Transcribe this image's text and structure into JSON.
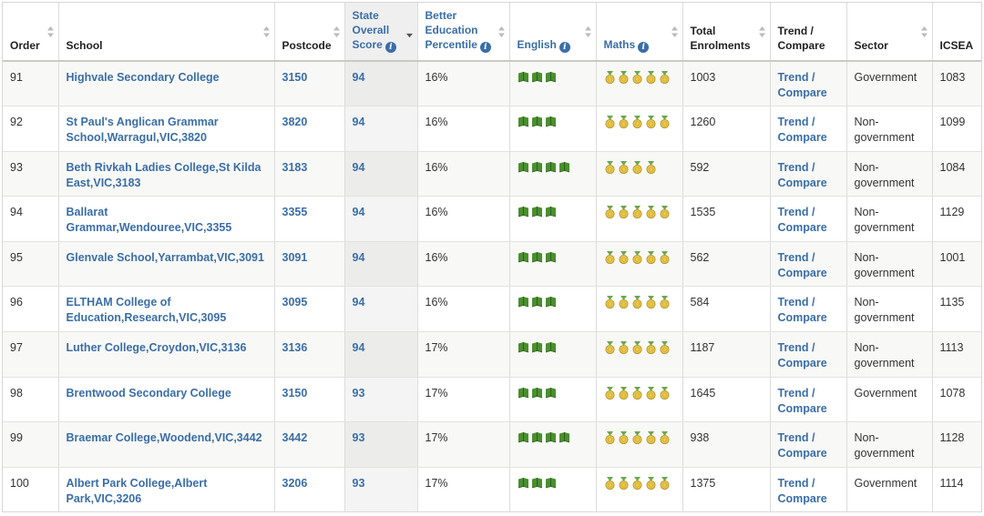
{
  "colors": {
    "link": "#3a6ea8",
    "book_green": "#4a8f2f",
    "medal_gold": "#e8c84a",
    "medal_ribbon": "#6aa84f"
  },
  "icons": {
    "english": "book-icon",
    "maths": "medal-icon",
    "info": "info-icon",
    "sort": "sort-arrows-icon"
  },
  "headers": {
    "order": "Order",
    "school": "School",
    "postcode": "Postcode",
    "state_score": [
      "State",
      "Overall",
      "Score"
    ],
    "better_education": [
      "Better",
      "Education",
      "Percentile"
    ],
    "english": "English",
    "maths": "Maths",
    "total": [
      "Total",
      "Enrolments"
    ],
    "trend": [
      "Trend /",
      "Compare"
    ],
    "sector": "Sector",
    "icsea": "ICSEA"
  },
  "sorted_by": "State Overall Score",
  "rows": [
    {
      "order": "91",
      "school": "Highvale Secondary College",
      "postcode": "3150",
      "score": "94",
      "percentile": "16%",
      "english": 3,
      "maths": 5,
      "total": "1003",
      "trend": [
        "Trend /",
        "Compare"
      ],
      "sector": "Government",
      "icsea": "1083"
    },
    {
      "order": "92",
      "school": "St Paul's Anglican Grammar School,Warragul,VIC,3820",
      "postcode": "3820",
      "score": "94",
      "percentile": "16%",
      "english": 3,
      "maths": 5,
      "total": "1260",
      "trend": [
        "Trend /",
        "Compare"
      ],
      "sector": "Non-government",
      "icsea": "1099"
    },
    {
      "order": "93",
      "school": "Beth Rivkah Ladies College,St Kilda East,VIC,3183",
      "postcode": "3183",
      "score": "94",
      "percentile": "16%",
      "english": 4,
      "maths": 4,
      "total": "592",
      "trend": [
        "Trend /",
        "Compare"
      ],
      "sector": "Non-government",
      "icsea": "1084"
    },
    {
      "order": "94",
      "school": "Ballarat Grammar,Wendouree,VIC,3355",
      "postcode": "3355",
      "score": "94",
      "percentile": "16%",
      "english": 3,
      "maths": 5,
      "total": "1535",
      "trend": [
        "Trend /",
        "Compare"
      ],
      "sector": "Non-government",
      "icsea": "1129"
    },
    {
      "order": "95",
      "school": "Glenvale School,Yarrambat,VIC,3091",
      "postcode": "3091",
      "score": "94",
      "percentile": "16%",
      "english": 3,
      "maths": 5,
      "total": "562",
      "trend": [
        "Trend /",
        "Compare"
      ],
      "sector": "Non-government",
      "icsea": "1001"
    },
    {
      "order": "96",
      "school": "ELTHAM College of Education,Research,VIC,3095",
      "postcode": "3095",
      "score": "94",
      "percentile": "16%",
      "english": 3,
      "maths": 5,
      "total": "584",
      "trend": [
        "Trend /",
        "Compare"
      ],
      "sector": "Non-government",
      "icsea": "1135"
    },
    {
      "order": "97",
      "school": "Luther College,Croydon,VIC,3136",
      "postcode": "3136",
      "score": "94",
      "percentile": "17%",
      "english": 3,
      "maths": 5,
      "total": "1187",
      "trend": [
        "Trend /",
        "Compare"
      ],
      "sector": "Non-government",
      "icsea": "1113"
    },
    {
      "order": "98",
      "school": "Brentwood Secondary College",
      "postcode": "3150",
      "score": "93",
      "percentile": "17%",
      "english": 3,
      "maths": 5,
      "total": "1645",
      "trend": [
        "Trend /",
        "Compare"
      ],
      "sector": "Government",
      "icsea": "1078"
    },
    {
      "order": "99",
      "school": "Braemar College,Woodend,VIC,3442",
      "postcode": "3442",
      "score": "93",
      "percentile": "17%",
      "english": 4,
      "maths": 5,
      "total": "938",
      "trend": [
        "Trend /",
        "Compare"
      ],
      "sector": "Non-government",
      "icsea": "1128"
    },
    {
      "order": "100",
      "school": "Albert Park College,Albert Park,VIC,3206",
      "postcode": "3206",
      "score": "93",
      "percentile": "17%",
      "english": 3,
      "maths": 5,
      "total": "1375",
      "trend": [
        "Trend /",
        "Compare"
      ],
      "sector": "Government",
      "icsea": "1114"
    }
  ]
}
